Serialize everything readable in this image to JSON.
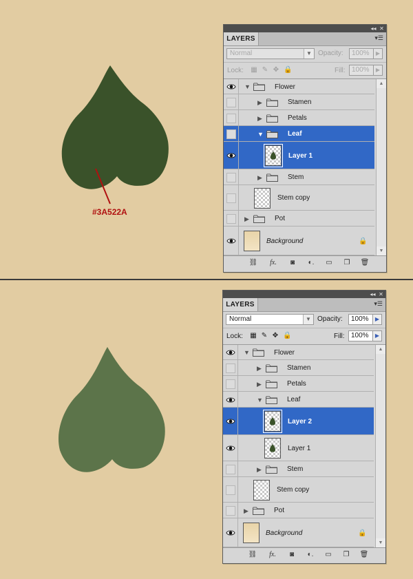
{
  "colors": {
    "background": "#e2cca2",
    "leaf_dark": "#3A522A",
    "leaf_light": "#5c744a",
    "annotation": "#b01010",
    "selection": "#3168c6"
  },
  "annotation": {
    "hex_label": "#3A522A"
  },
  "panel1": {
    "tab": "LAYERS",
    "blend_mode": "Normal",
    "opacity_label": "Opacity:",
    "opacity_value": "100%",
    "lock_label": "Lock:",
    "fill_label": "Fill:",
    "fill_value": "100%",
    "layers": [
      {
        "name": "Flower",
        "type": "group",
        "expanded": true,
        "visible": true
      },
      {
        "name": "Stamen",
        "type": "group",
        "expanded": false,
        "visible": false
      },
      {
        "name": "Petals",
        "type": "group",
        "expanded": false,
        "visible": false
      },
      {
        "name": "Leaf",
        "type": "group",
        "expanded": true,
        "visible": false,
        "selected": true
      },
      {
        "name": "Layer 1",
        "type": "layer",
        "visible": true,
        "selected": true
      },
      {
        "name": "Stem",
        "type": "group",
        "expanded": false,
        "visible": false
      },
      {
        "name": "Stem copy",
        "type": "layer",
        "visible": false
      },
      {
        "name": "Pot",
        "type": "group",
        "expanded": false,
        "visible": false
      },
      {
        "name": "Background",
        "type": "background",
        "visible": true,
        "locked": true
      }
    ]
  },
  "panel2": {
    "tab": "LAYERS",
    "blend_mode": "Normal",
    "opacity_label": "Opacity:",
    "opacity_value": "100%",
    "lock_label": "Lock:",
    "fill_label": "Fill:",
    "fill_value": "100%",
    "layers": [
      {
        "name": "Flower",
        "type": "group",
        "expanded": true,
        "visible": true
      },
      {
        "name": "Stamen",
        "type": "group",
        "expanded": false,
        "visible": false
      },
      {
        "name": "Petals",
        "type": "group",
        "expanded": false,
        "visible": false
      },
      {
        "name": "Leaf",
        "type": "group",
        "expanded": true,
        "visible": true
      },
      {
        "name": "Layer 2",
        "type": "layer",
        "visible": true,
        "selected": true
      },
      {
        "name": "Layer 1",
        "type": "layer",
        "visible": true
      },
      {
        "name": "Stem",
        "type": "group",
        "expanded": false,
        "visible": false
      },
      {
        "name": "Stem copy",
        "type": "layer",
        "visible": false
      },
      {
        "name": "Pot",
        "type": "group",
        "expanded": false,
        "visible": false
      },
      {
        "name": "Background",
        "type": "background",
        "visible": true,
        "locked": true
      }
    ]
  },
  "icons": {
    "eye": "eye-icon",
    "folder": "folder-icon",
    "lock": "lock-icon",
    "link": "link-icon",
    "fx": "fx-icon",
    "mask": "mask-icon",
    "adjustment": "adjustment-icon",
    "new_group": "new-group-icon",
    "new_layer": "new-layer-icon",
    "trash": "trash-icon"
  }
}
